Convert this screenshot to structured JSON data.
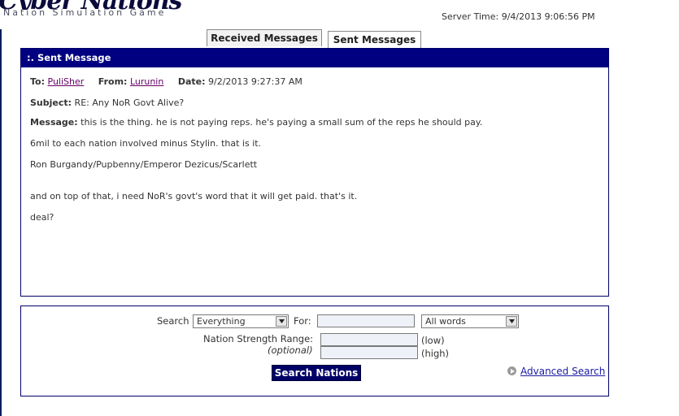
{
  "header": {
    "logo_text": "Cyber Nations",
    "tagline": "Nation Simulation Game",
    "server_time_label": "Server Time:",
    "server_time_value": "9/4/2013 9:06:56 PM"
  },
  "tabs": [
    {
      "label": "Received Messages",
      "active": false
    },
    {
      "label": "Sent Messages",
      "active": true
    }
  ],
  "message_panel": {
    "title": ":. Sent Message",
    "to_label": "To:",
    "to_value": "PuliSher",
    "from_label": "From:",
    "from_value": "Lurunin",
    "date_label": "Date:",
    "date_value": "9/2/2013 9:27:37 AM",
    "subject_label": "Subject:",
    "subject_value": "RE: Any NoR Govt Alive?",
    "message_label": "Message:",
    "lines": [
      "this is the thing. he is not paying reps. he's paying a small sum of the reps he should pay.",
      "6mil to each nation involved minus Stylin. that is it.",
      "Ron Burgandy/Pupbenny/Emperor Dezicus/Scarlett",
      "and on top of that, i need NoR's govt's word that it will get paid. that's it.",
      "deal?"
    ]
  },
  "search": {
    "search_label": "Search",
    "search_in_value": "Everything",
    "for_label": "For:",
    "for_value": "",
    "match_value": "All words",
    "strength_label": "Nation Strength Range:",
    "optional_label": "(optional)",
    "low_label": "(low)",
    "high_label": "(high)",
    "low_value": "",
    "high_value": "",
    "button_label": "Search Nations",
    "advanced_link": "Advanced Search"
  },
  "colors": {
    "panel_header_bg": "#000080",
    "border": "#00006a",
    "link": "#660066",
    "button_bg": "#000066"
  }
}
